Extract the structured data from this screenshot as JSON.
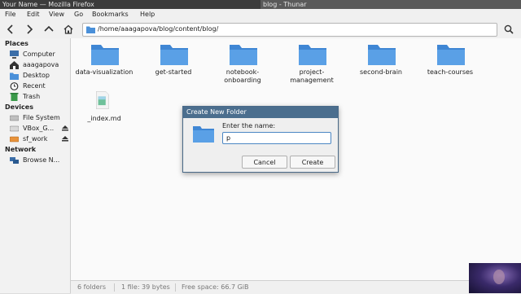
{
  "taskbar": {
    "inactive_window": "Your Name — Mozilla Firefox",
    "active_window": "blog - Thunar"
  },
  "menubar": {
    "items": [
      "File",
      "Edit",
      "View",
      "Go",
      "Bookmarks",
      "Help"
    ]
  },
  "toolbar": {
    "back_icon": "chevron-left-icon",
    "forward_icon": "chevron-right-icon",
    "up_icon": "chevron-up-icon",
    "home_icon": "home-icon",
    "location_path": "/home/aaagapova/blog/content/blog/",
    "search_icon": "search-icon"
  },
  "sidebar": {
    "places_header": "Places",
    "places": [
      {
        "label": "Computer",
        "icon": "computer-icon"
      },
      {
        "label": "aaagapova",
        "icon": "home-icon"
      },
      {
        "label": "Desktop",
        "icon": "desktop-icon"
      },
      {
        "label": "Recent",
        "icon": "clock-icon"
      },
      {
        "label": "Trash",
        "icon": "trash-icon"
      }
    ],
    "devices_header": "Devices",
    "devices": [
      {
        "label": "File System",
        "icon": "drive-icon"
      },
      {
        "label": "VBox_G...",
        "icon": "drive-icon"
      },
      {
        "label": "sf_work",
        "icon": "drive-icon"
      }
    ],
    "network_header": "Network",
    "network": [
      {
        "label": "Browse N...",
        "icon": "network-icon"
      }
    ]
  },
  "files": [
    {
      "name": "data-visualization",
      "type": "folder"
    },
    {
      "name": "get-started",
      "type": "folder"
    },
    {
      "name": "notebook-onboarding",
      "type": "folder"
    },
    {
      "name": "project-management",
      "type": "folder"
    },
    {
      "name": "second-brain",
      "type": "folder"
    },
    {
      "name": "teach-courses",
      "type": "folder"
    },
    {
      "name": "_index.md",
      "type": "markdown"
    }
  ],
  "statusbar": {
    "folders": "6 folders",
    "files": "1 file: 39 bytes",
    "free_space": "Free space: 66.7 GiB"
  },
  "dialog": {
    "title": "Create New Folder",
    "label": "Enter the name:",
    "input_value": "p",
    "cancel_label": "Cancel",
    "create_label": "Create"
  },
  "colors": {
    "folder_blue": "#4a90d9",
    "dialog_title_bg": "#4b6e8e",
    "accent_focus": "#4b86c3"
  }
}
